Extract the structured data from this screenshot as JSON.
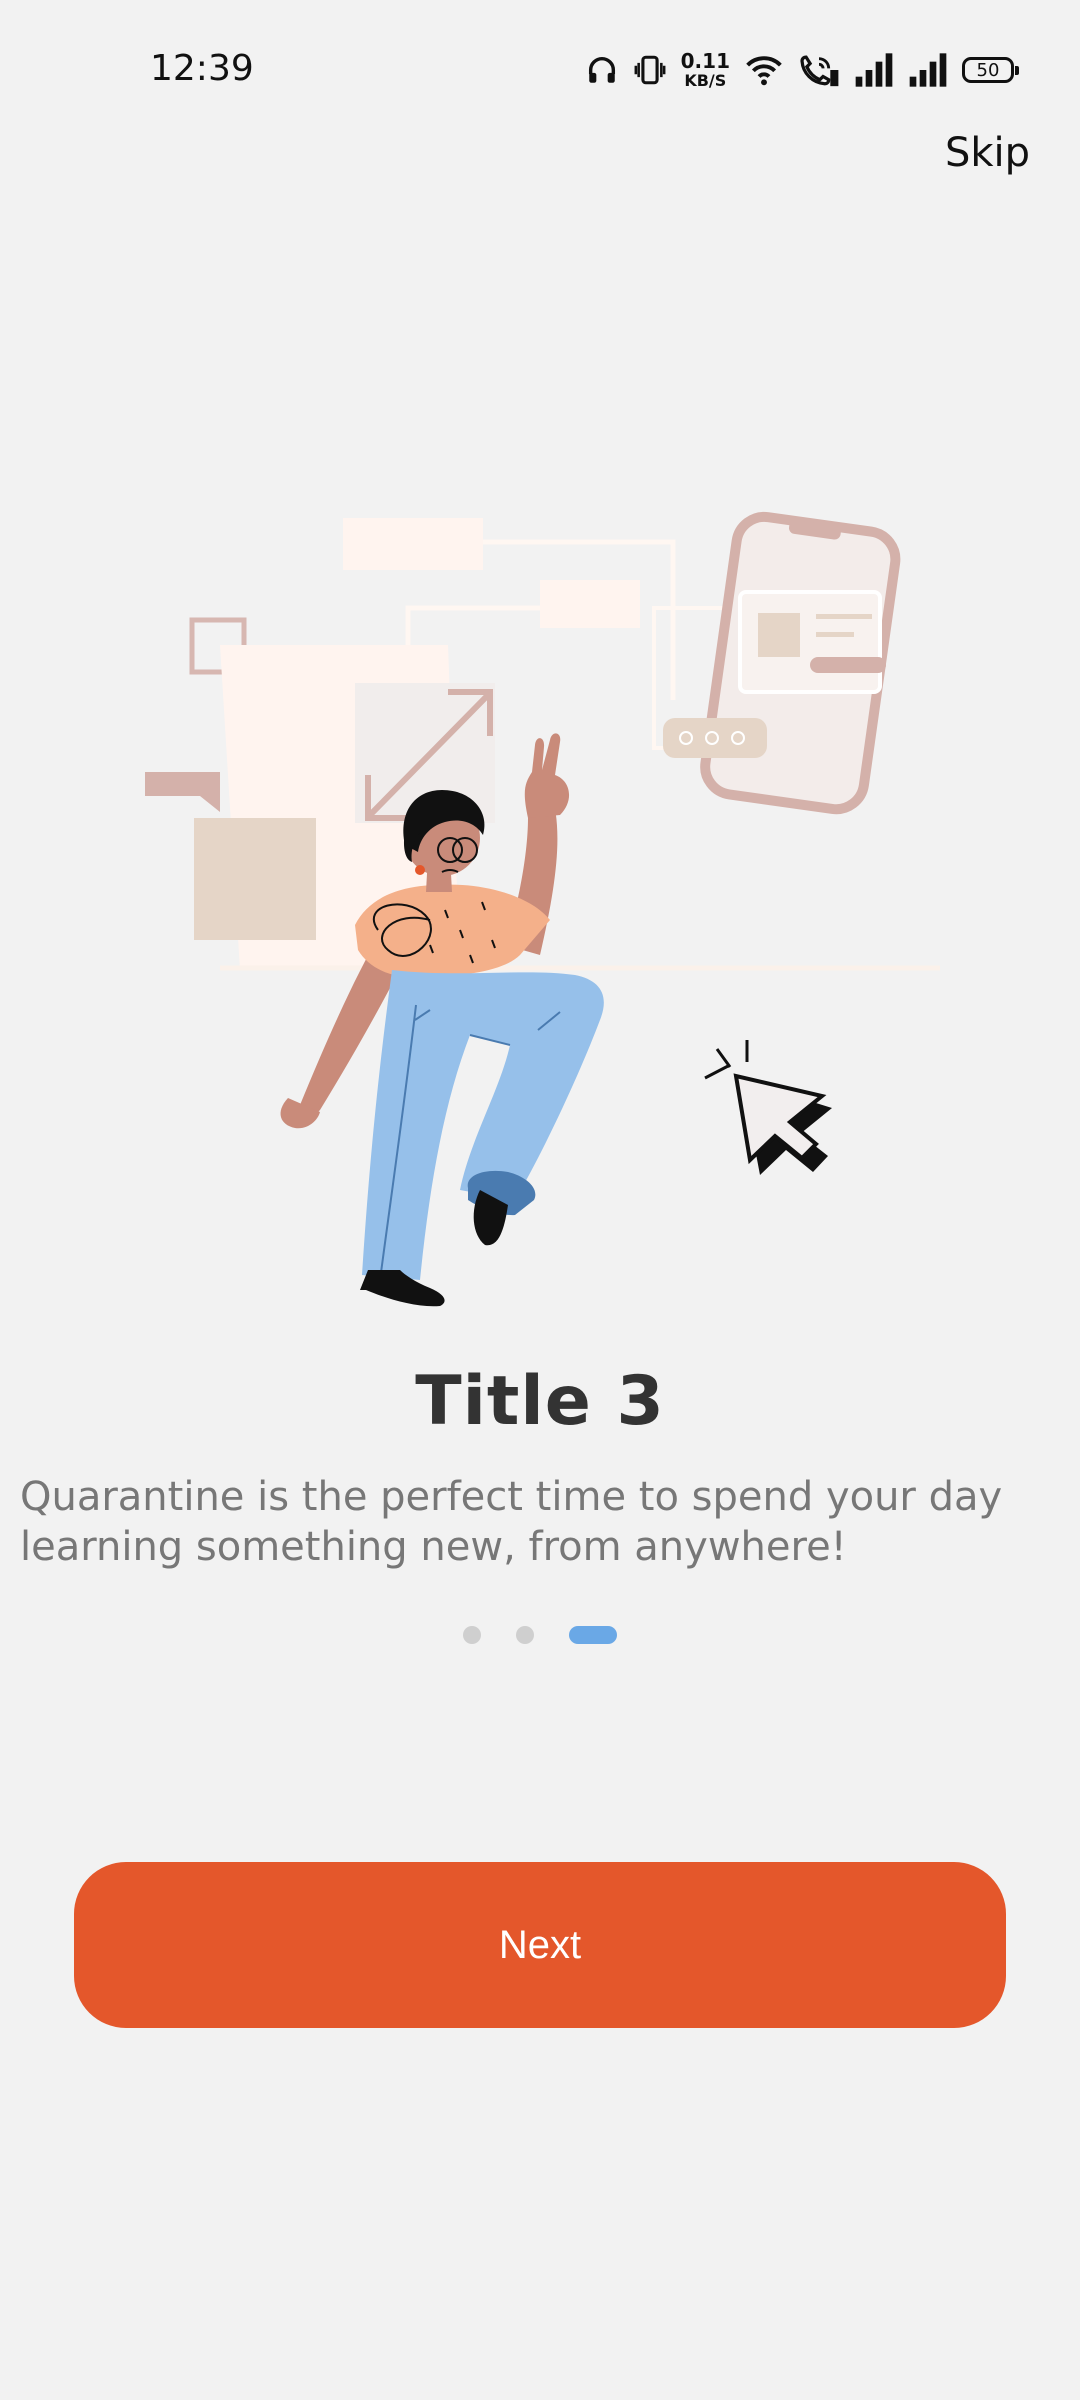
{
  "status_bar": {
    "time": "12:39",
    "net_speed_value": "0.11",
    "net_speed_unit": "KB/S",
    "battery_level": "50"
  },
  "header": {
    "skip_label": "Skip"
  },
  "slide": {
    "title": "Title 3",
    "description": "Quarantine is the perfect time to spend your day learning something new, from anywhere!"
  },
  "pager": {
    "total": 3,
    "current": 3
  },
  "footer": {
    "next_label": "Next"
  },
  "colors": {
    "background": "#f2f2f2",
    "accent": "#e4572b",
    "indicator_active": "#6aa8e6",
    "indicator_inactive": "#cfcfcf"
  }
}
